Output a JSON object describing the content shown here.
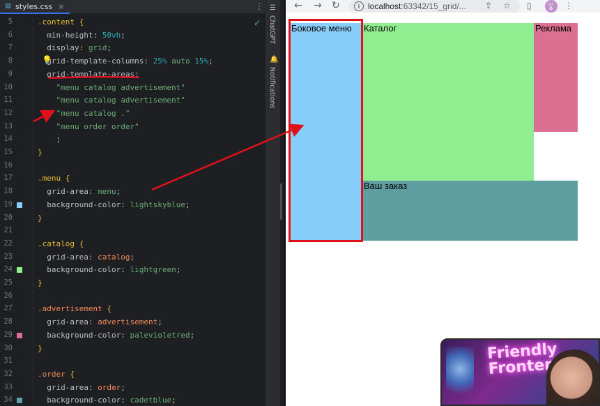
{
  "editor": {
    "tab": {
      "filename": "styles.css",
      "icon": "css-file-icon",
      "close_glyph": "×"
    },
    "menu_glyph": "⋮",
    "check_glyph": "✓",
    "bulb_glyph": "💡",
    "lines": [
      {
        "n": "5",
        "parts": [
          [
            "sel",
            ".content"
          ],
          [
            "punc",
            " "
          ],
          [
            "br",
            "{"
          ]
        ]
      },
      {
        "n": "6",
        "parts": [
          [
            "prop",
            "  min-height"
          ],
          [
            "punc",
            ": "
          ],
          [
            "num",
            "50vh"
          ],
          [
            "punc",
            ";"
          ]
        ]
      },
      {
        "n": "7",
        "parts": [
          [
            "prop",
            "  display"
          ],
          [
            "punc",
            ": "
          ],
          [
            "val",
            "grid"
          ],
          [
            "punc",
            ";"
          ]
        ]
      },
      {
        "n": "8",
        "parts": [
          [
            "prop",
            "  grid-template-columns"
          ],
          [
            "punc",
            ": "
          ],
          [
            "num",
            "25%"
          ],
          [
            "punc",
            " "
          ],
          [
            "val",
            "auto"
          ],
          [
            "punc",
            " "
          ],
          [
            "num",
            "15%"
          ],
          [
            "punc",
            ";"
          ]
        ]
      },
      {
        "n": "9",
        "parts": [
          [
            "prop",
            "  grid-template-areas"
          ],
          [
            "punc",
            ":"
          ]
        ]
      },
      {
        "n": "10",
        "parts": [
          [
            "str",
            "    \"menu catalog advertisement\""
          ]
        ]
      },
      {
        "n": "11",
        "parts": [
          [
            "str",
            "    \"menu catalog advertisement\""
          ]
        ]
      },
      {
        "n": "12",
        "parts": [
          [
            "str",
            "    \"menu catalog .\""
          ]
        ]
      },
      {
        "n": "13",
        "parts": [
          [
            "str",
            "    \"menu order order\""
          ]
        ]
      },
      {
        "n": "14",
        "parts": [
          [
            "punc",
            "    ;"
          ]
        ]
      },
      {
        "n": "15",
        "parts": [
          [
            "br",
            "}"
          ]
        ]
      },
      {
        "n": "16",
        "parts": []
      },
      {
        "n": "17",
        "parts": [
          [
            "sel",
            ".menu"
          ],
          [
            "punc",
            " "
          ],
          [
            "br",
            "{"
          ]
        ]
      },
      {
        "n": "18",
        "parts": [
          [
            "prop",
            "  grid-area"
          ],
          [
            "punc",
            ": "
          ],
          [
            "val",
            "menu"
          ],
          [
            "punc",
            ";"
          ]
        ]
      },
      {
        "n": "19",
        "parts": [
          [
            "prop",
            "  background-color"
          ],
          [
            "punc",
            ": "
          ],
          [
            "val",
            "lightskyblue"
          ],
          [
            "punc",
            ";"
          ]
        ]
      },
      {
        "n": "20",
        "parts": [
          [
            "br",
            "}"
          ]
        ]
      },
      {
        "n": "21",
        "parts": []
      },
      {
        "n": "22",
        "parts": [
          [
            "sel",
            ".catalog"
          ],
          [
            "punc",
            " "
          ],
          [
            "br",
            "{"
          ]
        ]
      },
      {
        "n": "23",
        "parts": [
          [
            "prop",
            "  grid-area"
          ],
          [
            "punc",
            ": "
          ],
          [
            "hl-name",
            "catalog"
          ],
          [
            "punc",
            ";"
          ]
        ]
      },
      {
        "n": "24",
        "parts": [
          [
            "prop",
            "  background-color"
          ],
          [
            "punc",
            ": "
          ],
          [
            "val",
            "lightgreen"
          ],
          [
            "punc",
            ";"
          ]
        ]
      },
      {
        "n": "25",
        "parts": [
          [
            "br",
            "}"
          ]
        ]
      },
      {
        "n": "26",
        "parts": []
      },
      {
        "n": "27",
        "parts": [
          [
            "hl-name",
            ".advertisement"
          ],
          [
            "punc",
            " "
          ],
          [
            "br",
            "{"
          ]
        ]
      },
      {
        "n": "28",
        "parts": [
          [
            "prop",
            "  grid-area"
          ],
          [
            "punc",
            ": "
          ],
          [
            "hl-name",
            "advertisement"
          ],
          [
            "punc",
            ";"
          ]
        ]
      },
      {
        "n": "29",
        "parts": [
          [
            "prop",
            "  background-color"
          ],
          [
            "punc",
            ": "
          ],
          [
            "val",
            "palevioletred"
          ],
          [
            "punc",
            ";"
          ]
        ]
      },
      {
        "n": "30",
        "parts": [
          [
            "br",
            "}"
          ]
        ]
      },
      {
        "n": "31",
        "parts": []
      },
      {
        "n": "32",
        "parts": [
          [
            "hl-name",
            ".order"
          ],
          [
            "punc",
            " "
          ],
          [
            "br",
            "{"
          ]
        ]
      },
      {
        "n": "33",
        "parts": [
          [
            "prop",
            "  grid-area"
          ],
          [
            "punc",
            ": "
          ],
          [
            "hl-name",
            "order"
          ],
          [
            "punc",
            ";"
          ]
        ]
      },
      {
        "n": "34",
        "parts": [
          [
            "prop",
            "  background-color"
          ],
          [
            "punc",
            ": "
          ],
          [
            "val",
            "cadetblue"
          ],
          [
            "punc",
            ";"
          ]
        ]
      }
    ],
    "swatches": [
      {
        "line": "19",
        "color": "#87cefa"
      },
      {
        "line": "24",
        "color": "#90ee90"
      },
      {
        "line": "29",
        "color": "#db7093"
      },
      {
        "line": "34",
        "color": "#5f9ea0"
      }
    ],
    "toolstrip": {
      "chatgpt_label": "ChatGPT",
      "notifications_label": "Notifications",
      "chatgpt_icon": "chatgpt-icon",
      "bell_icon": "bell-icon"
    }
  },
  "browser": {
    "back_glyph": "←",
    "forward_glyph": "→",
    "reload_glyph": "↻",
    "url_host": "localhost",
    "url_path": ":63342/15_grid/...",
    "share_glyph": "⇪",
    "star_glyph": "☆",
    "sidepanel_glyph": "▯",
    "ext_glyph": "🐰",
    "grid": {
      "menu_label": "Боковое меню",
      "catalog_label": "Каталог",
      "ad_label": "Реклама",
      "order_label": "Ваш заказ"
    }
  },
  "webcam": {
    "neon_text_1": "Friendly",
    "neon_text_2": "Frontend"
  },
  "colors": {
    "annotation_red": "#e1111b",
    "menu": "lightskyblue",
    "catalog": "lightgreen",
    "advertisement": "palevioletred",
    "order": "cadetblue"
  }
}
